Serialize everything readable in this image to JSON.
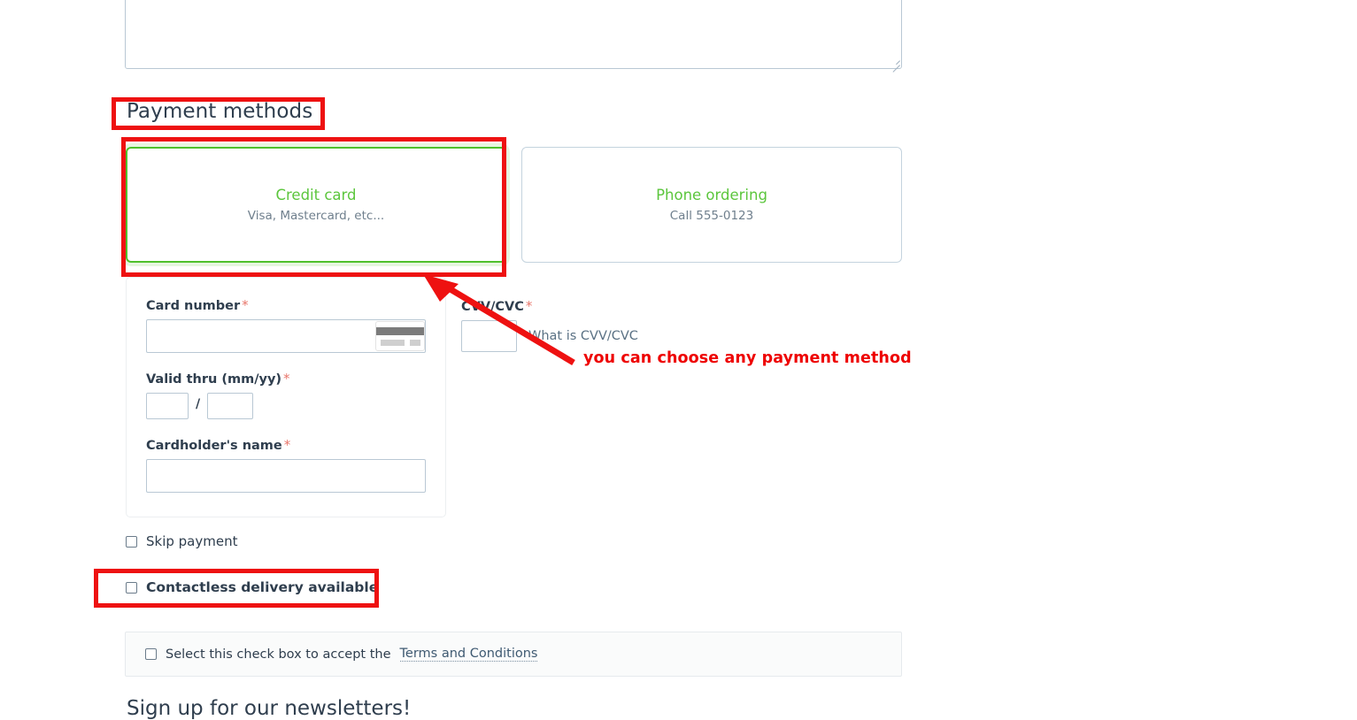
{
  "form": {
    "notes_textarea": {
      "value": "",
      "placeholder": ""
    },
    "section_heading": "Payment methods",
    "payment_methods": [
      {
        "name": "credit-card",
        "title": "Credit card",
        "subtitle": "Visa, Mastercard, etc...",
        "selected": true
      },
      {
        "name": "phone-ordering",
        "title": "Phone ordering",
        "subtitle": "Call 555-0123",
        "selected": false
      }
    ],
    "card_fields": {
      "card_number_label": "Card number",
      "card_number_value": "",
      "card_brand_icon": "credit-card-icon",
      "valid_thru_label": "Valid thru (mm/yy)",
      "valid_thru_month": "",
      "valid_thru_separator": "/",
      "valid_thru_year": "",
      "cardholder_label": "Cardholder's name",
      "cardholder_value": "",
      "cvv_label": "CVV/CVC",
      "cvv_value": "",
      "cvv_help": "What is CVV/CVC",
      "required_marker": "*"
    },
    "skip_payment": {
      "label": "Skip payment",
      "checked": false
    },
    "contactless": {
      "label": "Contactless delivery available",
      "checked": false
    },
    "terms": {
      "text": "Select this check box to accept the",
      "link": "Terms and Conditions",
      "checked": false
    },
    "newsletter_heading": "Sign up for our newsletters!"
  },
  "annotations": {
    "callout_text": "you can choose any payment method",
    "highlight_color": "#ee1111",
    "callout_color": "#ee0000",
    "highlighted": [
      "Payment methods",
      "Credit card",
      "Contactless delivery available"
    ]
  },
  "colors": {
    "accent_green": "#5cc63d",
    "selected_border": "#4fc02c",
    "input_border": "#b9c8d4",
    "text": "#2f3e4e",
    "muted": "#6f7f8d",
    "required_star": "#e8766b",
    "link": "#3f5a72"
  }
}
